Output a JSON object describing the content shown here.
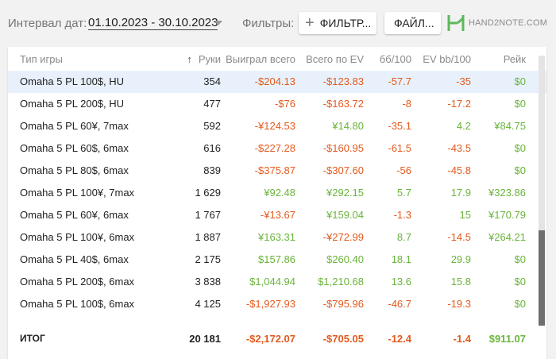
{
  "toolbar": {
    "date_label": "Интервал дат:",
    "date_range": "01.10.2023 - 30.10.2023",
    "filters_label": "Фильтры:",
    "filter_button": "ФИЛЬТР...",
    "file_button": "ФАЙЛ...",
    "logo_text": "HAND2NOTE.COM",
    "logo_color": "#5cb85c"
  },
  "table": {
    "columns": [
      "Тип игры",
      "Руки",
      "Выиграл всего",
      "Всего по EV",
      "бб/100",
      "EV bb/100",
      "Рейк"
    ],
    "sorted_column": "Руки",
    "rows": [
      {
        "name": "Omaha 5 PL 100$, HU",
        "hands": "354",
        "won": "-$204.13",
        "ev": "-$123.83",
        "bb100": "-57.7",
        "evbb100": "-35",
        "rake": "$0",
        "selected": true
      },
      {
        "name": "Omaha 5 PL 200$, HU",
        "hands": "477",
        "won": "-$76",
        "ev": "-$163.72",
        "bb100": "-8",
        "evbb100": "-17.2",
        "rake": "$0"
      },
      {
        "name": "Omaha 5 PL 60¥, 7max",
        "hands": "592",
        "won": "-¥124.53",
        "ev": "¥14.80",
        "bb100": "-35.1",
        "evbb100": "4.2",
        "rake": "¥84.75"
      },
      {
        "name": "Omaha 5 PL 60$, 6max",
        "hands": "616",
        "won": "-$227.28",
        "ev": "-$160.95",
        "bb100": "-61.5",
        "evbb100": "-43.5",
        "rake": "$0"
      },
      {
        "name": "Omaha 5 PL 80$, 6max",
        "hands": "839",
        "won": "-$375.87",
        "ev": "-$307.60",
        "bb100": "-56",
        "evbb100": "-45.8",
        "rake": "$0"
      },
      {
        "name": "Omaha 5 PL 100¥, 7max",
        "hands": "1 629",
        "won": "¥92.48",
        "ev": "¥292.15",
        "bb100": "5.7",
        "evbb100": "17.9",
        "rake": "¥323.86"
      },
      {
        "name": "Omaha 5 PL 60¥, 6max",
        "hands": "1 767",
        "won": "-¥13.67",
        "ev": "¥159.04",
        "bb100": "-1.3",
        "evbb100": "15",
        "rake": "¥170.79"
      },
      {
        "name": "Omaha 5 PL 100¥, 6max",
        "hands": "1 887",
        "won": "¥163.31",
        "ev": "-¥272.99",
        "bb100": "8.7",
        "evbb100": "-14.5",
        "rake": "¥264.21"
      },
      {
        "name": "Omaha 5 PL 40$, 6max",
        "hands": "2 175",
        "won": "$157.86",
        "ev": "$260.40",
        "bb100": "18.1",
        "evbb100": "29.9",
        "rake": "$0"
      },
      {
        "name": "Omaha 5 PL 200$, 6max",
        "hands": "3 838",
        "won": "$1,044.94",
        "ev": "$1,210.68",
        "bb100": "13.6",
        "evbb100": "15.8",
        "rake": "$0"
      },
      {
        "name": "Omaha 5 PL 100$, 6max",
        "hands": "4 125",
        "won": "-$1,927.93",
        "ev": "-$795.96",
        "bb100": "-46.7",
        "evbb100": "-19.3",
        "rake": "$0"
      }
    ],
    "total": {
      "name": "ИТОГ",
      "hands": "20 181",
      "won": "-$2,172.07",
      "ev": "-$705.05",
      "bb100": "-12.4",
      "evbb100": "-1.4",
      "rake": "$911.07"
    }
  },
  "colors": {
    "negative": "#e35a1e",
    "positive": "#6ab43b",
    "selected_row": "#e8f1fb"
  }
}
